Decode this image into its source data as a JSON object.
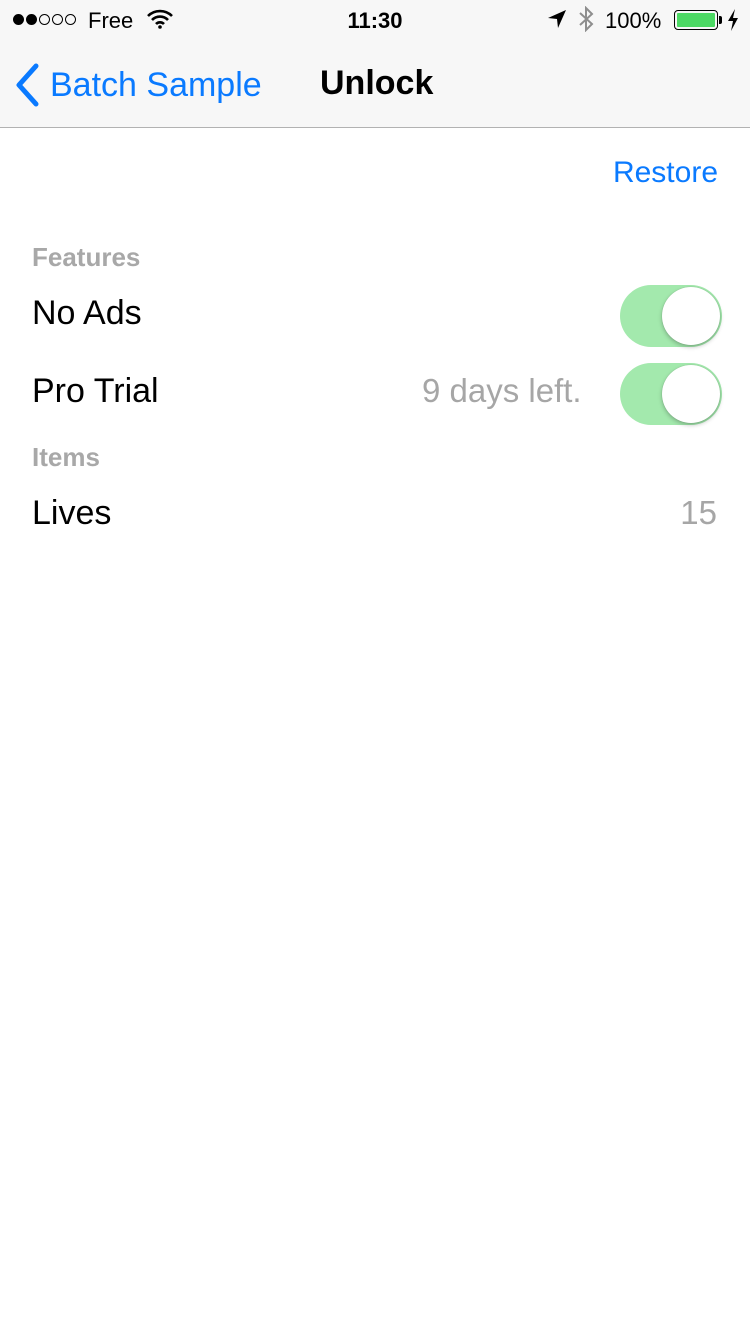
{
  "status_bar": {
    "carrier": "Free",
    "time": "11:30",
    "battery_percent": "100%",
    "signal_bars_filled": 2,
    "signal_bars_total": 5
  },
  "navbar": {
    "back_label": "Batch Sample",
    "title": "Unlock"
  },
  "actions": {
    "restore_label": "Restore"
  },
  "sections": {
    "features": {
      "header": "Features",
      "rows": [
        {
          "label": "No Ads",
          "toggle_on": true
        },
        {
          "label": "Pro Trial",
          "detail": "9 days left.",
          "toggle_on": true
        }
      ]
    },
    "items": {
      "header": "Items",
      "rows": [
        {
          "label": "Lives",
          "value": "15"
        }
      ]
    }
  },
  "colors": {
    "accent": "#0a7aff",
    "toggle_on": "#a3e9ad",
    "battery": "#4cd964",
    "secondary_text": "#a8a8a8"
  },
  "icons": [
    "wifi-icon",
    "location-arrow-icon",
    "bluetooth-icon",
    "battery-icon",
    "charging-bolt-icon",
    "back-chevron-icon"
  ]
}
